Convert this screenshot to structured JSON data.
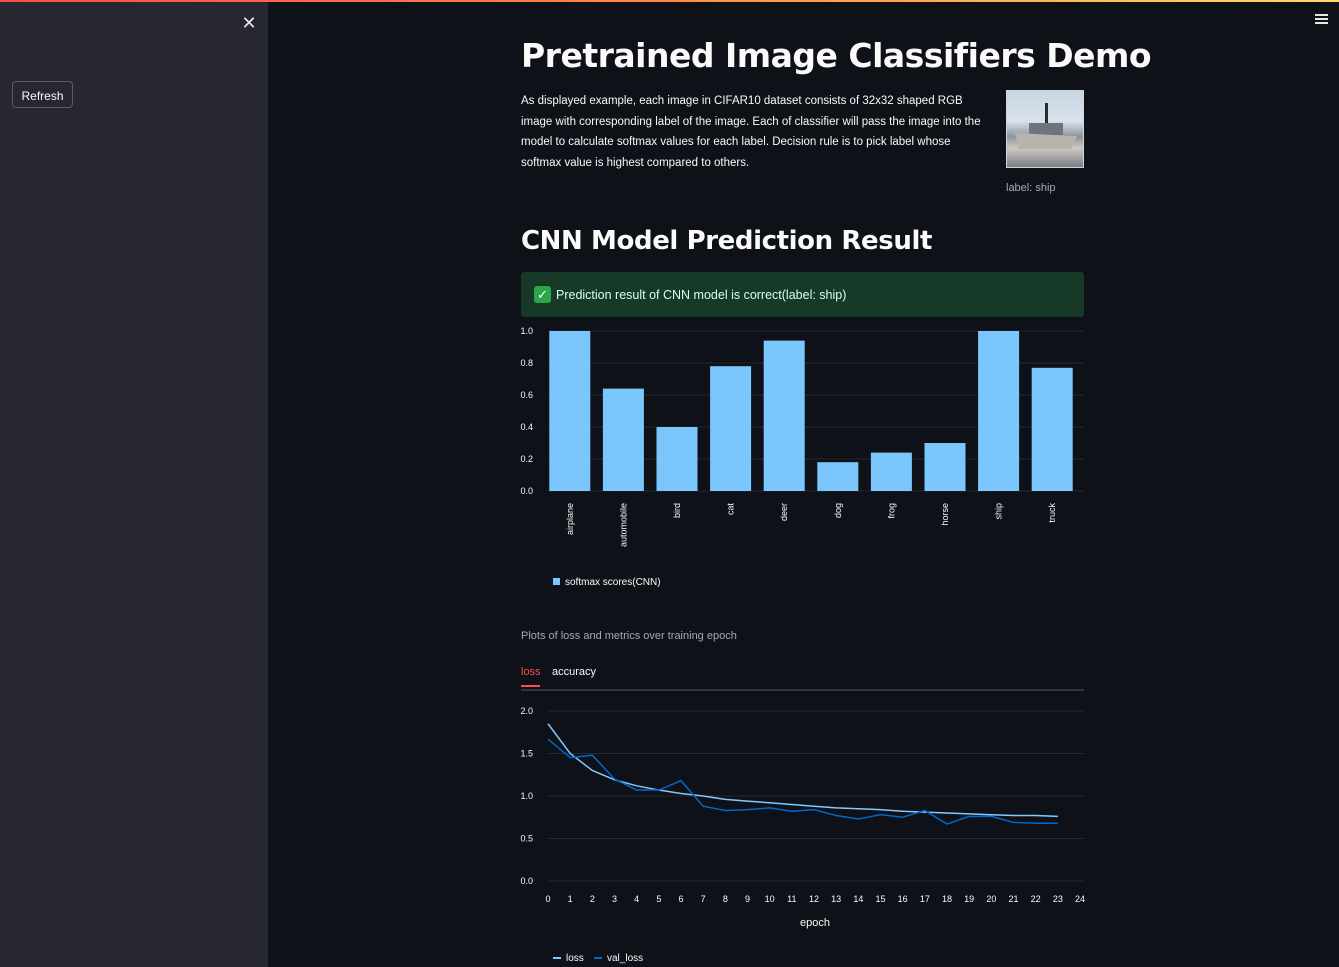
{
  "app": {
    "accent": "#ff4b4b"
  },
  "sidebar": {
    "refresh_label": "Refresh"
  },
  "header": {
    "title": "Pretrained Image Classifiers Demo"
  },
  "intro": {
    "text": "As displayed example, each image in CIFAR10 dataset consists of 32x32 shaped RGB image with corresponding label of the image. Each of classifier will pass the image into the model to calculate softmax values for each label. Decision rule is to pick label whose softmax value is highest compared to others.",
    "image_caption": "label: ship"
  },
  "section": {
    "title": "CNN Model Prediction Result",
    "success_text": "Prediction result of CNN model is correct(label: ship)"
  },
  "plots_caption": "Plots of loss and metrics over training epoch",
  "tabs": [
    {
      "label": "loss",
      "active": true
    },
    {
      "label": "accuracy",
      "active": false
    }
  ],
  "chart_data": [
    {
      "type": "bar",
      "categories": [
        "airplane",
        "automobile",
        "bird",
        "cat",
        "deer",
        "dog",
        "frog",
        "horse",
        "ship",
        "truck"
      ],
      "series": [
        {
          "name": "softmax scores(CNN)",
          "values": [
            1.0,
            0.64,
            0.4,
            0.78,
            0.94,
            0.18,
            0.24,
            0.3,
            1.0,
            0.77
          ],
          "color": "#7cc6fe"
        }
      ],
      "yticks": [
        "0.0",
        "0.2",
        "0.4",
        "0.6",
        "0.8",
        "1.0"
      ],
      "ylim": [
        0,
        1.0
      ],
      "legend": "bottom-left"
    },
    {
      "type": "line",
      "x": [
        0,
        1,
        2,
        3,
        4,
        5,
        6,
        7,
        8,
        9,
        10,
        11,
        12,
        13,
        14,
        15,
        16,
        17,
        18,
        19,
        20,
        21,
        22,
        23
      ],
      "xticks": [
        "0",
        "1",
        "2",
        "3",
        "4",
        "5",
        "6",
        "7",
        "8",
        "9",
        "10",
        "11",
        "12",
        "13",
        "14",
        "15",
        "16",
        "17",
        "18",
        "19",
        "20",
        "21",
        "22",
        "23",
        "24"
      ],
      "yticks": [
        "0.0",
        "0.5",
        "1.0",
        "1.5",
        "2.0"
      ],
      "xlabel": "epoch",
      "ylim": [
        0,
        2.0
      ],
      "xlim": [
        0,
        24
      ],
      "series": [
        {
          "name": "loss",
          "color": "#83c9ff",
          "values": [
            1.85,
            1.5,
            1.3,
            1.19,
            1.12,
            1.07,
            1.03,
            1.0,
            0.96,
            0.94,
            0.92,
            0.9,
            0.88,
            0.86,
            0.85,
            0.84,
            0.82,
            0.81,
            0.8,
            0.79,
            0.78,
            0.77,
            0.77,
            0.76
          ]
        },
        {
          "name": "val_loss",
          "color": "#0068c9",
          "values": [
            1.67,
            1.45,
            1.48,
            1.2,
            1.07,
            1.07,
            1.18,
            0.88,
            0.83,
            0.84,
            0.86,
            0.82,
            0.84,
            0.77,
            0.73,
            0.78,
            0.75,
            0.83,
            0.67,
            0.76,
            0.76,
            0.69,
            0.68,
            0.68
          ]
        }
      ],
      "legend": "bottom-left"
    }
  ]
}
